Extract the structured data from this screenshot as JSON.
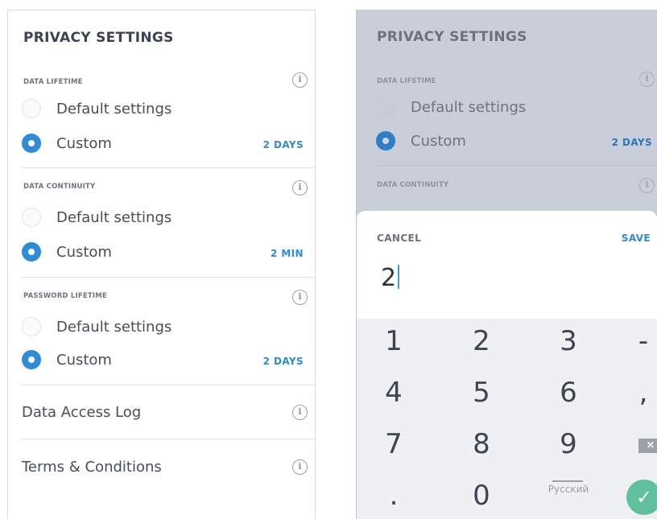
{
  "settings": {
    "title": "PRIVACY SETTINGS",
    "sections": [
      {
        "label": "DATA LIFETIME",
        "options": [
          "Default settings",
          "Custom"
        ],
        "selected": "Custom",
        "value": "2 DAYS"
      },
      {
        "label": "DATA CONTINUITY",
        "options": [
          "Default settings",
          "Custom"
        ],
        "selected": "Custom",
        "value": "2 MIN"
      },
      {
        "label": "PASSWORD LIFETIME",
        "options": [
          "Default settings",
          "Custom"
        ],
        "selected": "Custom",
        "value": "2 DAYS"
      }
    ],
    "rows": [
      "Data Access Log",
      "Terms & Conditions"
    ],
    "info_glyph": "i"
  },
  "input_sheet": {
    "cancel_label": "CANCEL",
    "save_label": "SAVE",
    "input_value": "2"
  },
  "keypad": {
    "keys": [
      "1",
      "2",
      "3",
      "-",
      "4",
      "5",
      "6",
      ",",
      "7",
      "8",
      "9",
      ".",
      "0"
    ],
    "language": "Русский",
    "backspace_icon": "backspace-icon",
    "confirm_icon": "checkmark-icon",
    "confirm_glyph": "✓"
  },
  "colors": {
    "accent": "#2e8bd8",
    "confirm": "#5fc09b",
    "overlay": "#c9ced8"
  }
}
